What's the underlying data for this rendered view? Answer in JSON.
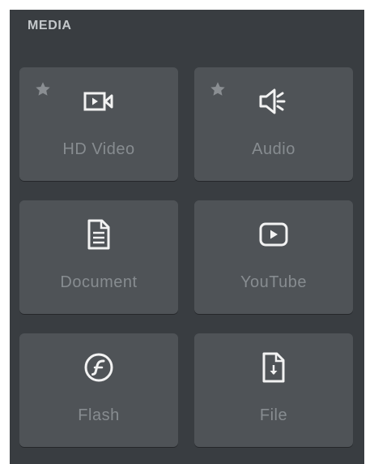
{
  "panel": {
    "title": "MEDIA",
    "colors": {
      "background": "#393d41",
      "tile": "#4f5357",
      "icon": "#f2f2f2",
      "label": "#878c90",
      "star": "#8a8e92"
    }
  },
  "tiles": [
    {
      "label": "HD Video",
      "icon": "video-camera-icon",
      "starred": true
    },
    {
      "label": "Audio",
      "icon": "speaker-icon",
      "starred": true
    },
    {
      "label": "Document",
      "icon": "document-icon",
      "starred": false
    },
    {
      "label": "YouTube",
      "icon": "play-button-icon",
      "starred": false
    },
    {
      "label": "Flash",
      "icon": "flash-icon",
      "starred": false
    },
    {
      "label": "File",
      "icon": "file-download-icon",
      "starred": false
    }
  ]
}
